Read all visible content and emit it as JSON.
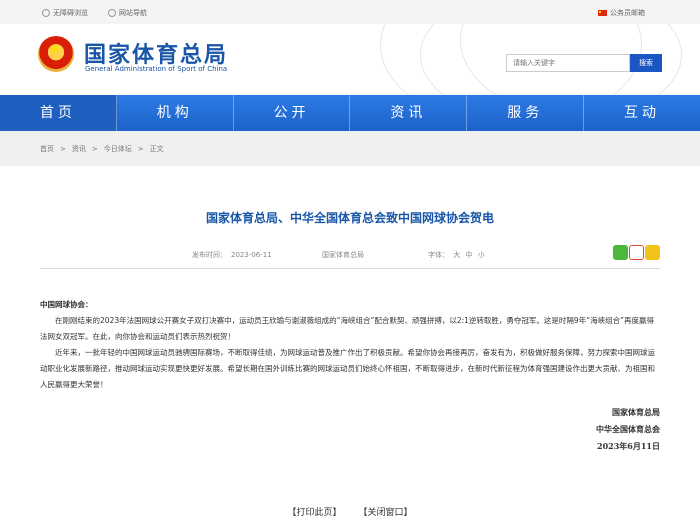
{
  "topbar": {
    "accessible": "无障碍浏览",
    "site_nav": "网站导航",
    "email": "公务员邮箱"
  },
  "header": {
    "title_cn": "国家体育总局",
    "title_en": "General Administration of Sport of China",
    "search_placeholder": "请输入关键字",
    "search_button": "搜索"
  },
  "nav": {
    "items": [
      {
        "label": "首页"
      },
      {
        "label": "机构"
      },
      {
        "label": "公开"
      },
      {
        "label": "资讯"
      },
      {
        "label": "服务"
      },
      {
        "label": "互动"
      }
    ]
  },
  "breadcrumb": {
    "items": [
      "首页",
      "资讯",
      "今日体坛",
      "正文"
    ],
    "separator": ">"
  },
  "article": {
    "title": "国家体育总局、中华全国体育总会致中国网球协会贺电",
    "publish_label": "发布时间：",
    "publish_date": "2023-06-11",
    "source": "国家体育总局",
    "font_label": "字体：",
    "font_sizes": [
      "大",
      "中",
      "小"
    ],
    "greeting": "中国网球协会：",
    "paragraphs": [
      "在刚刚结束的2023年法国网球公开赛女子双打决赛中，运动员王欣瑜与谢淑薇组成的“海峡组合”配合默契、顽强拼搏，以2:1逆转取胜，勇夺冠军。这是时隔9年“海峡组合”再度赢得法网女双冠军。在此，向你协会和运动员们表示热烈祝贺！",
      "近年来，一批年轻的中国网球运动员驰骋国际赛场，不断取得佳绩，为网球运动普及推广作出了积极贡献。希望你协会再接再厉，奋发有为，积极做好服务保障，努力探索中国网球运动职业化发展新路径，推动网球运动实现更快更好发展。希望长期在国外训练比赛的网球运动员们始终心怀祖国，不断取得进步，在新时代新征程为体育强国建设作出更大贡献、为祖国和人民赢得更大荣誉！"
    ],
    "signature": [
      "国家体育总局",
      "中华全国体育总会",
      "2023年6月11日"
    ]
  },
  "footer": {
    "print": "【打印此页】",
    "close": "【关闭窗口】"
  },
  "colors": {
    "brand_blue": "#1a56a8",
    "nav_blue": "#2d7be5"
  }
}
